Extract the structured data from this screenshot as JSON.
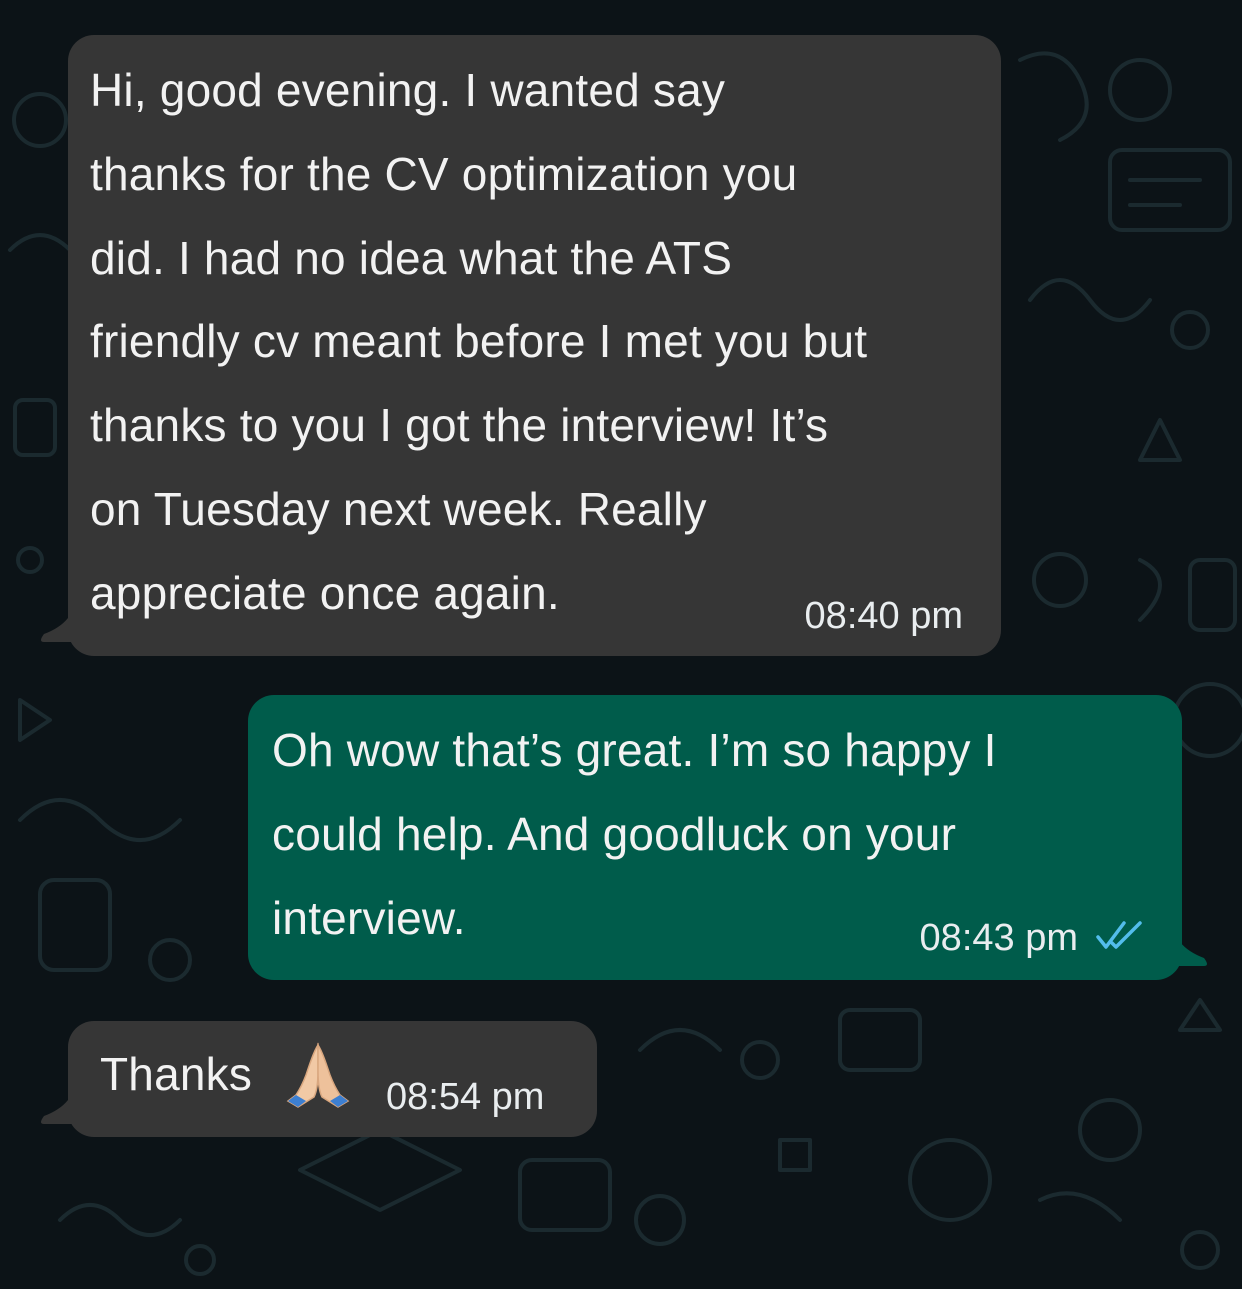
{
  "chat": {
    "messages": [
      {
        "direction": "incoming",
        "text": "Hi, good evening. I wanted say\nthanks for the CV optimization you\ndid. I had no idea what the ATS\nfriendly cv meant before I met you but\nthanks to you I got the interview! It’s\non Tuesday next week. Really\nappreciate once again.",
        "time": "08:40 pm"
      },
      {
        "direction": "outgoing",
        "text": "Oh wow that’s great. I’m so happy I\ncould help. And goodluck on your\ninterview.",
        "time": "08:43 pm",
        "status_icon": "double-check-read-icon"
      },
      {
        "direction": "incoming",
        "text": "Thanks",
        "emoji_icon": "folded-hands-emoji-icon",
        "time": "08:54 pm"
      }
    ]
  },
  "colors": {
    "background": "#0c1317",
    "incoming_bubble": "#363636",
    "outgoing_bubble": "#005c4b",
    "read_check": "#53bdeb"
  }
}
